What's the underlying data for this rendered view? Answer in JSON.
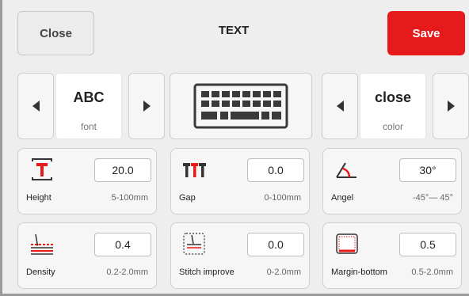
{
  "header": {
    "close_label": "Close",
    "title": "TEXT",
    "save_label": "Save"
  },
  "font_selector": {
    "value": "ABC",
    "caption": "font"
  },
  "color_selector": {
    "value": "close",
    "caption": "color"
  },
  "keyboard": {
    "icon": "keyboard-icon"
  },
  "params": {
    "height": {
      "label": "Height",
      "value": "20.0",
      "range": "5-100mm",
      "icon": "text-height-icon"
    },
    "gap": {
      "label": "Gap",
      "value": "0.0",
      "range": "0-100mm",
      "icon": "letter-gap-icon"
    },
    "angel": {
      "label": "Angel",
      "value": "30°",
      "range": "-45°— 45°",
      "icon": "angle-icon"
    },
    "density": {
      "label": "Density",
      "value": "0.4",
      "range": "0.2-2.0mm",
      "icon": "density-icon"
    },
    "stitch_improve": {
      "label": "Stitch improve",
      "value": "0.0",
      "range": "0-2.0mm",
      "icon": "stitch-improve-icon"
    },
    "margin_bottom": {
      "label": "Margin-bottom",
      "value": "0.5",
      "range": "0.5-2.0mm",
      "icon": "margin-bottom-icon"
    }
  },
  "colors": {
    "accent": "#e61a1a",
    "background": "#eeeeee",
    "card": "#f6f6f6"
  }
}
